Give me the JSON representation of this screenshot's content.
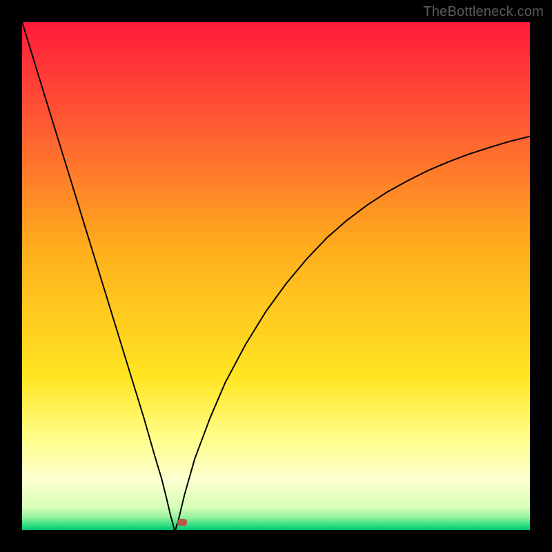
{
  "watermark": "TheBottleneck.com",
  "chart_data": {
    "type": "line",
    "title": "",
    "xlabel": "",
    "ylabel": "",
    "xlim": [
      0,
      100
    ],
    "ylim": [
      0,
      100
    ],
    "grid": false,
    "background": {
      "kind": "vertical-gradient",
      "stops": [
        {
          "pos": 0.0,
          "color": "#ff1a3a"
        },
        {
          "pos": 0.2,
          "color": "#ff5a33"
        },
        {
          "pos": 0.45,
          "color": "#ffaf1d"
        },
        {
          "pos": 0.7,
          "color": "#ffe522"
        },
        {
          "pos": 0.82,
          "color": "#fffe8a"
        },
        {
          "pos": 0.9,
          "color": "#fcffd0"
        },
        {
          "pos": 0.955,
          "color": "#d7ffb8"
        },
        {
          "pos": 0.975,
          "color": "#96f2a0"
        },
        {
          "pos": 0.99,
          "color": "#33e07f"
        },
        {
          "pos": 1.0,
          "color": "#00c876"
        }
      ]
    },
    "series": [
      {
        "name": "left-branch",
        "color": "#000000",
        "x": [
          0,
          2,
          4,
          6,
          8,
          10,
          12,
          14,
          16,
          18,
          20,
          22,
          24,
          26,
          27.5,
          28.5,
          29.2,
          29.7,
          30.0
        ],
        "y": [
          100,
          93.5,
          87,
          80.5,
          74,
          67.5,
          61,
          54.5,
          48,
          41.5,
          35,
          28.5,
          22,
          15,
          10,
          6,
          3,
          1.2,
          0
        ]
      },
      {
        "name": "right-branch",
        "color": "#000000",
        "x": [
          30.2,
          30.8,
          32,
          34,
          37,
          40,
          44,
          48,
          52,
          56,
          60,
          64,
          68,
          72,
          76,
          80,
          84,
          88,
          92,
          96,
          100
        ],
        "y": [
          0,
          2,
          7,
          14,
          22,
          29,
          36.5,
          43,
          48.5,
          53.3,
          57.5,
          61,
          64,
          66.6,
          68.8,
          70.8,
          72.5,
          74,
          75.3,
          76.5,
          77.5
        ]
      }
    ],
    "marker": {
      "x": 31.5,
      "y": 1.5,
      "color": "#b55a4a"
    }
  }
}
